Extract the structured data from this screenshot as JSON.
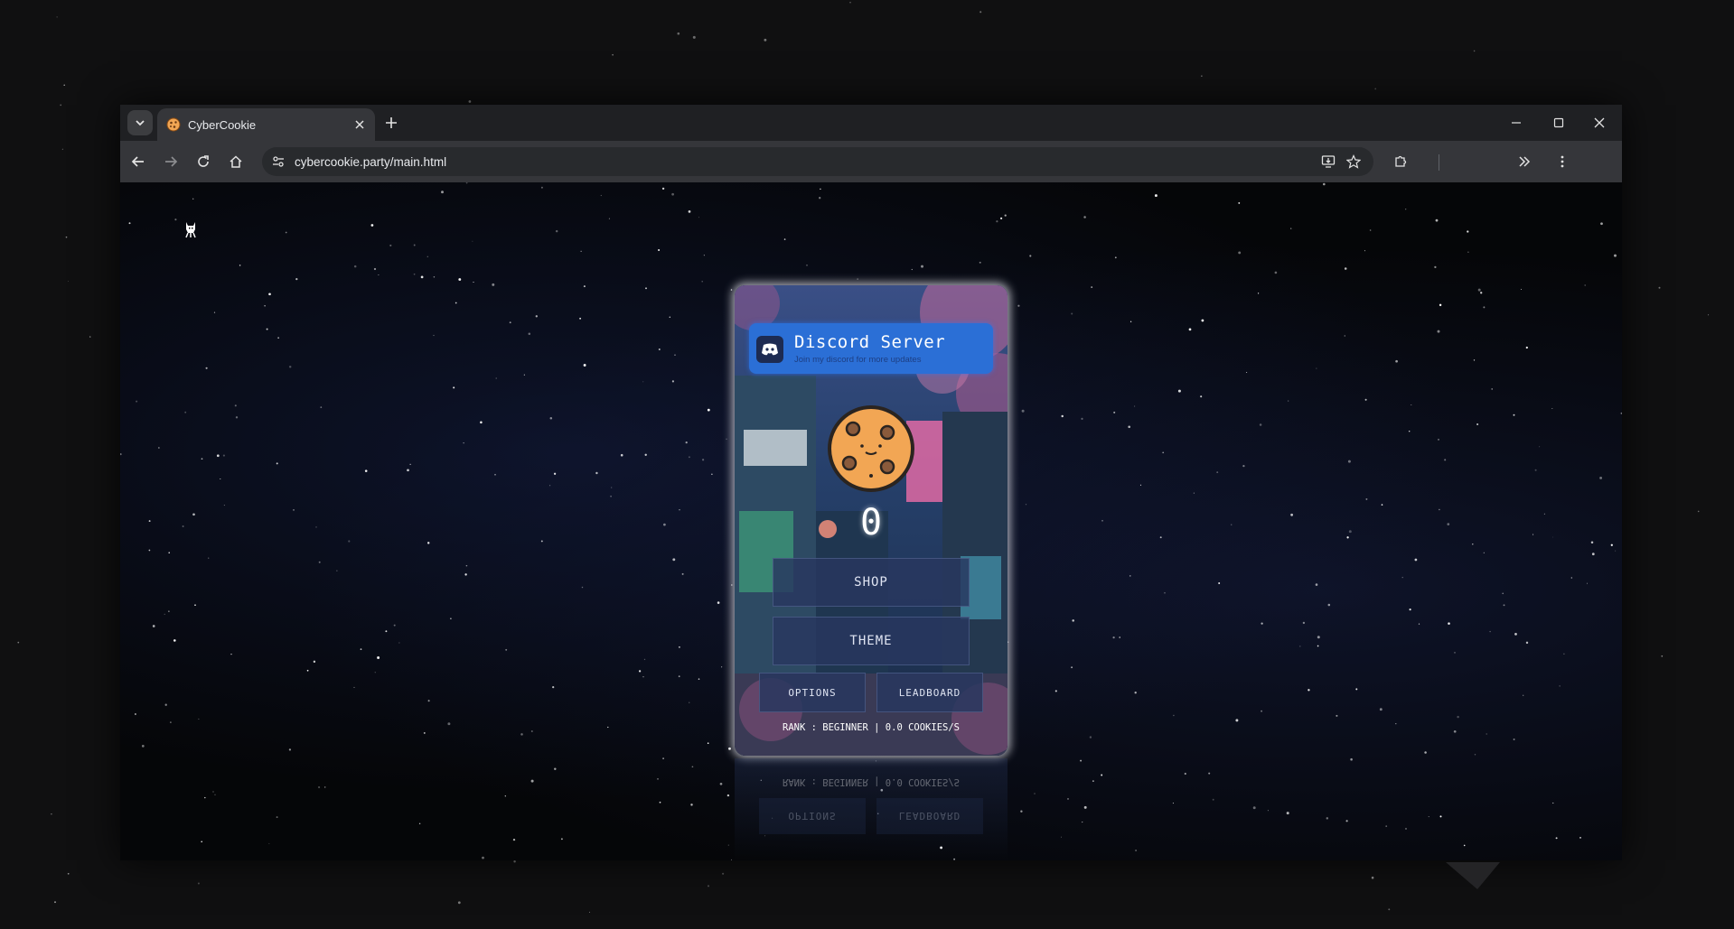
{
  "browser": {
    "tab": {
      "title": "CyberCookie"
    },
    "toolbar": {
      "url": "cybercookie.party/main.html"
    },
    "icons": {
      "tab_search": "chevron-down-icon",
      "close_tab": "close-icon",
      "new_tab": "plus-icon",
      "minimize": "minimize-icon",
      "maximize": "maximize-icon",
      "close_window": "close-icon",
      "back": "arrow-left-icon",
      "forward": "arrow-right-icon",
      "reload": "reload-icon",
      "home": "home-icon",
      "site_info": "tune-icon",
      "install": "install-app-icon",
      "bookmark": "star-icon",
      "extensions": "puzzle-icon",
      "more_tools": "double-chevron-right-icon",
      "menu": "kebab-menu-icon"
    },
    "colors": {
      "frame": "#202124",
      "toolbar": "#35363a",
      "omnibox": "#282a2d"
    }
  },
  "page": {
    "discord": {
      "title": "Discord Server",
      "subtitle": "Join my discord for more updates"
    },
    "cookie_count": "0",
    "buttons": {
      "shop": "SHOP",
      "theme": "THEME",
      "options": "OPTIONS",
      "leaderboard": "LEADBOARD"
    },
    "rank_line": "RANK : BEGINNER | 0.0 COOKIES/S",
    "colors": {
      "discord_blue": "#2b6fd6",
      "cookie": "#f2a654",
      "cookie_outline": "#2a2420",
      "button_bg": "#28375f"
    }
  }
}
